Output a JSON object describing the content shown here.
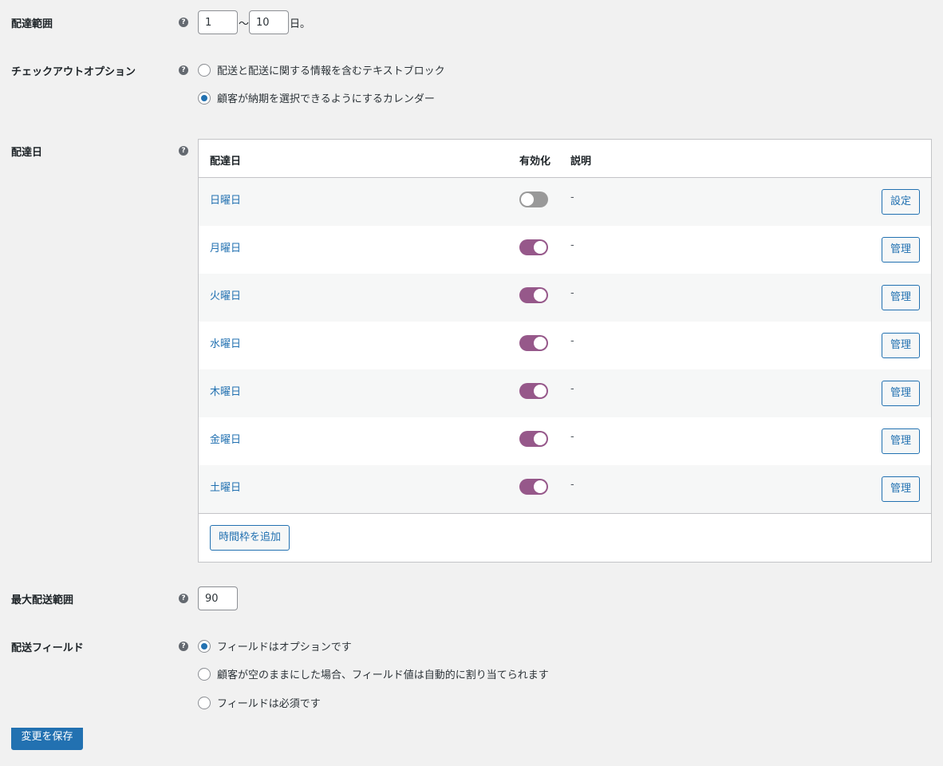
{
  "delivery_range": {
    "label": "配達範囲",
    "from": "1",
    "to": "10",
    "separator": "〜",
    "suffix": "日。"
  },
  "checkout_option": {
    "label": "チェックアウトオプション",
    "options": [
      {
        "label": "配送と配送に関する情報を含むテキストブロック",
        "selected": false
      },
      {
        "label": "顧客が納期を選択できるようにするカレンダー",
        "selected": true
      }
    ]
  },
  "delivery_days": {
    "label": "配達日",
    "headers": {
      "day": "配達日",
      "enabled": "有効化",
      "description": "説明"
    },
    "rows": [
      {
        "day": "日曜日",
        "enabled": false,
        "description": "-",
        "action": "設定"
      },
      {
        "day": "月曜日",
        "enabled": true,
        "description": "-",
        "action": "管理"
      },
      {
        "day": "火曜日",
        "enabled": true,
        "description": "-",
        "action": "管理"
      },
      {
        "day": "水曜日",
        "enabled": true,
        "description": "-",
        "action": "管理"
      },
      {
        "day": "木曜日",
        "enabled": true,
        "description": "-",
        "action": "管理"
      },
      {
        "day": "金曜日",
        "enabled": true,
        "description": "-",
        "action": "管理"
      },
      {
        "day": "土曜日",
        "enabled": true,
        "description": "-",
        "action": "管理"
      }
    ],
    "add_slot_label": "時間枠を追加"
  },
  "max_delivery_range": {
    "label": "最大配送範囲",
    "value": "90"
  },
  "delivery_field": {
    "label": "配送フィールド",
    "options": [
      {
        "label": "フィールドはオプションです",
        "selected": true
      },
      {
        "label": "顧客が空のままにした場合、フィールド値は自動的に割り当てられます",
        "selected": false
      },
      {
        "label": "フィールドは必須です",
        "selected": false
      }
    ]
  },
  "save_label": "変更を保存",
  "help_glyph": "?",
  "colors": {
    "accent": "#2271b1",
    "toggle_on": "#96588a",
    "toggle_off": "#999999"
  }
}
